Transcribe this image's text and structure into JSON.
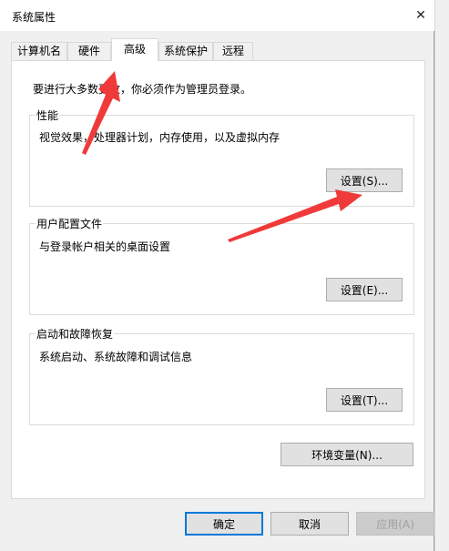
{
  "window": {
    "title": "系统属性",
    "close_glyph": "✕"
  },
  "tabs": [
    {
      "label": "计算机名",
      "active": false
    },
    {
      "label": "硬件",
      "active": false
    },
    {
      "label": "高级",
      "active": true
    },
    {
      "label": "系统保护",
      "active": false
    },
    {
      "label": "远程",
      "active": false
    }
  ],
  "admin_note": "要进行大多数更改，你必须作为管理员登录。",
  "performance": {
    "title": "性能",
    "description": "视觉效果，处理器计划，内存使用，以及虚拟内存",
    "button": "设置(S)..."
  },
  "user_profiles": {
    "title": "用户配置文件",
    "description": "与登录帐户相关的桌面设置",
    "button": "设置(E)..."
  },
  "startup_recovery": {
    "title": "启动和故障恢复",
    "description": "系统启动、系统故障和调试信息",
    "button": "设置(T)..."
  },
  "env_vars_button": "环境变量(N)...",
  "footer": {
    "ok": "确定",
    "cancel": "取消",
    "apply": "应用(A)"
  },
  "colors": {
    "annotation_arrow": "#f03a3a",
    "focus_border": "#0078d7"
  },
  "icons": [
    "close-icon"
  ]
}
